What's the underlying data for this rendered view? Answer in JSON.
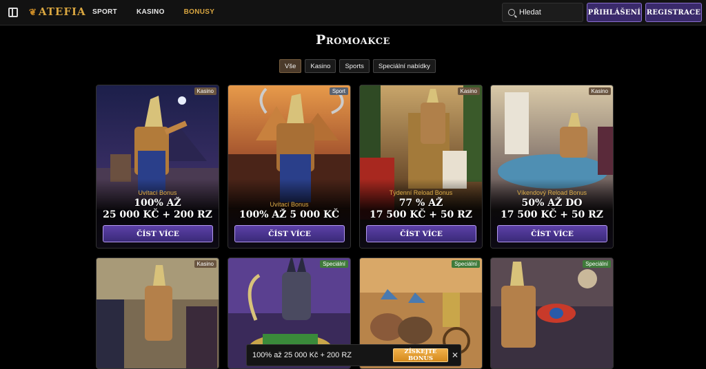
{
  "header": {
    "logo": "ATEFIA",
    "nav": [
      {
        "label": "SPORT"
      },
      {
        "label": "KASINO"
      },
      {
        "label": "BONUSY"
      }
    ],
    "search_placeholder": "Hledat",
    "login_label": "PŘIHLÁŠENÍ",
    "register_label": "REGISTRACE"
  },
  "page_title": "Promoakce",
  "tabs": [
    {
      "label": "Vše",
      "active": true
    },
    {
      "label": "Kasino"
    },
    {
      "label": "Sports"
    },
    {
      "label": "Speciální nabídky"
    }
  ],
  "cards": [
    {
      "badge": "Kasino",
      "subtitle": "Uvítací Bonus",
      "line1": "100% AŽ",
      "line2": "25 000 KČ + 200 RZ",
      "cta": "ČÍST VÍCE"
    },
    {
      "badge": "Sport",
      "subtitle": "Uvítací Bonus",
      "line1": "100% AŽ 5 000 KČ",
      "line2": "",
      "cta": "ČÍST VÍCE"
    },
    {
      "badge": "Kasino",
      "subtitle": "Týdenní Reload Bonus",
      "line1": "77 % AŽ",
      "line2": "17 500 KČ + 50 RZ",
      "cta": "ČÍST VÍCE"
    },
    {
      "badge": "Kasino",
      "subtitle": "Víkendový Reload Bonus",
      "line1": "50% AŽ DO",
      "line2": "17 500 KČ + 50 RZ",
      "cta": "ČÍST VÍCE"
    },
    {
      "badge": "Kasino"
    },
    {
      "badge": "Speciální"
    },
    {
      "badge": "Speciální"
    },
    {
      "badge": "Speciální"
    }
  ],
  "sticky": {
    "text": "100% až 25 000 Kč + 200 RZ",
    "button": "ZÍSKEJTE BONUS",
    "close": "✕"
  }
}
